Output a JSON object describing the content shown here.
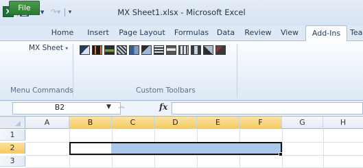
{
  "window": {
    "title": "MX Sheet1.xlsx - Microsoft Excel",
    "app_icon": "excel-icon",
    "quick_access": [
      "save-icon",
      "undo-icon",
      "redo-icon",
      "customize-icon"
    ]
  },
  "tabs": [
    "File",
    "Home",
    "Insert",
    "Page Layout",
    "Formulas",
    "Data",
    "Review",
    "View",
    "Add-Ins",
    "Tea"
  ],
  "active_tab": "Add-Ins",
  "ribbon": {
    "groups": [
      {
        "label": "Menu Commands",
        "items": [
          "MX Sheet"
        ]
      },
      {
        "label": "Custom Toolbars",
        "icon_count": 12
      }
    ],
    "mx_sheet_label": "MX Sheet",
    "dropdown_arrow": "▾"
  },
  "formula_bar": {
    "name_box": "B2",
    "fx_label": "fx",
    "formula": ""
  },
  "sheet": {
    "columns": [
      "A",
      "B",
      "C",
      "D",
      "E",
      "F",
      "G",
      "H"
    ],
    "rows": [
      "1",
      "2",
      "3"
    ],
    "selected_range": "B2:F2",
    "selected_columns": [
      "B",
      "C",
      "D",
      "E",
      "F"
    ],
    "selected_row": "2"
  },
  "colors": {
    "file_tab": "#2a7a30",
    "selection": "#aac9ea",
    "header_highlight": "#f6c95e"
  }
}
